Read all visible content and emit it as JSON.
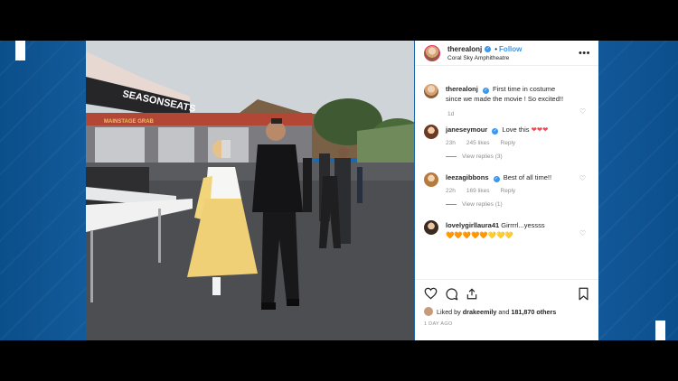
{
  "post": {
    "username": "therealonj",
    "follow_label": "Follow",
    "location": "Coral Sky Amphitheatre",
    "more_label": "•••"
  },
  "caption": {
    "username": "therealonj",
    "text": "First time in costume since we made the movie ! So excited!!",
    "age": "1d"
  },
  "comments": [
    {
      "username": "janeseymour",
      "text": "Love this",
      "emoji": "❤❤❤",
      "age": "23h",
      "likes": "245 likes",
      "reply": "Reply",
      "view_replies": "View replies (3)"
    },
    {
      "username": "leezagibbons",
      "text": "Best of all time!!",
      "age": "22h",
      "likes": "169 likes",
      "reply": "Reply",
      "view_replies": "View replies (1)"
    },
    {
      "username": "lovelygirllaura41",
      "text": "Girrrrl...yessss",
      "emoji": "🧡🧡🧡🧡🧡💛💛💛"
    }
  ],
  "likes": {
    "prefix": "Liked by",
    "user": "drakeemily",
    "and": "and",
    "count": "181,870 others"
  },
  "post_age": "1 DAY AGO",
  "photo": {
    "sign_text": "SEASONSEATS",
    "banner_text": "MAINSTAGE GRAB"
  },
  "colors": {
    "background_blue": "#1d6ab0",
    "instagram_blue": "#3897f0",
    "heart_red": "#ed4956"
  },
  "icons": {
    "verified": "verified-badge-icon",
    "like": "heart-outline-icon",
    "comment": "comment-bubble-icon",
    "share": "share-icon",
    "save": "bookmark-icon",
    "more": "more-dots-icon"
  }
}
